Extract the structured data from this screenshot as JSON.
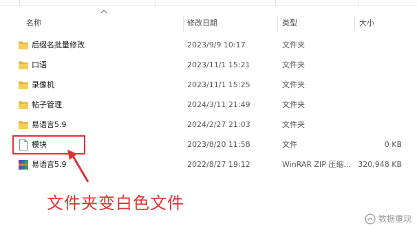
{
  "columns": {
    "name": "名称",
    "date": "修改日期",
    "type": "类型",
    "size": "大小"
  },
  "files": [
    {
      "name": "后缀名批量修改",
      "date": "2023/9/9 10:17",
      "type": "文件夹",
      "size": "",
      "icon": "folder-icon"
    },
    {
      "name": "口语",
      "date": "2023/11/1 15:21",
      "type": "文件夹",
      "size": "",
      "icon": "folder-icon"
    },
    {
      "name": "录像机",
      "date": "2023/11/1 15:25",
      "type": "文件夹",
      "size": "",
      "icon": "folder-icon"
    },
    {
      "name": "帖子管理",
      "date": "2024/3/11 21:49",
      "type": "文件夹",
      "size": "",
      "icon": "folder-icon"
    },
    {
      "name": "易语言5.9",
      "date": "2024/2/27 21:03",
      "type": "文件夹",
      "size": "",
      "icon": "folder-icon"
    },
    {
      "name": "模块",
      "date": "2023/8/20 11:58",
      "type": "文件",
      "size": "0 KB",
      "icon": "file-icon"
    },
    {
      "name": "易语言5.9",
      "date": "2022/8/27 19:12",
      "type": "WinRAR ZIP 压缩...",
      "size": "320,948 KB",
      "icon": "winrar-archive-icon"
    }
  ],
  "annotation": "文件夹变白色文件",
  "watermark": "数据重现",
  "colors": {
    "folder": "#f2c14e",
    "annotation": "#e8302e",
    "highlight": "#e03030"
  }
}
